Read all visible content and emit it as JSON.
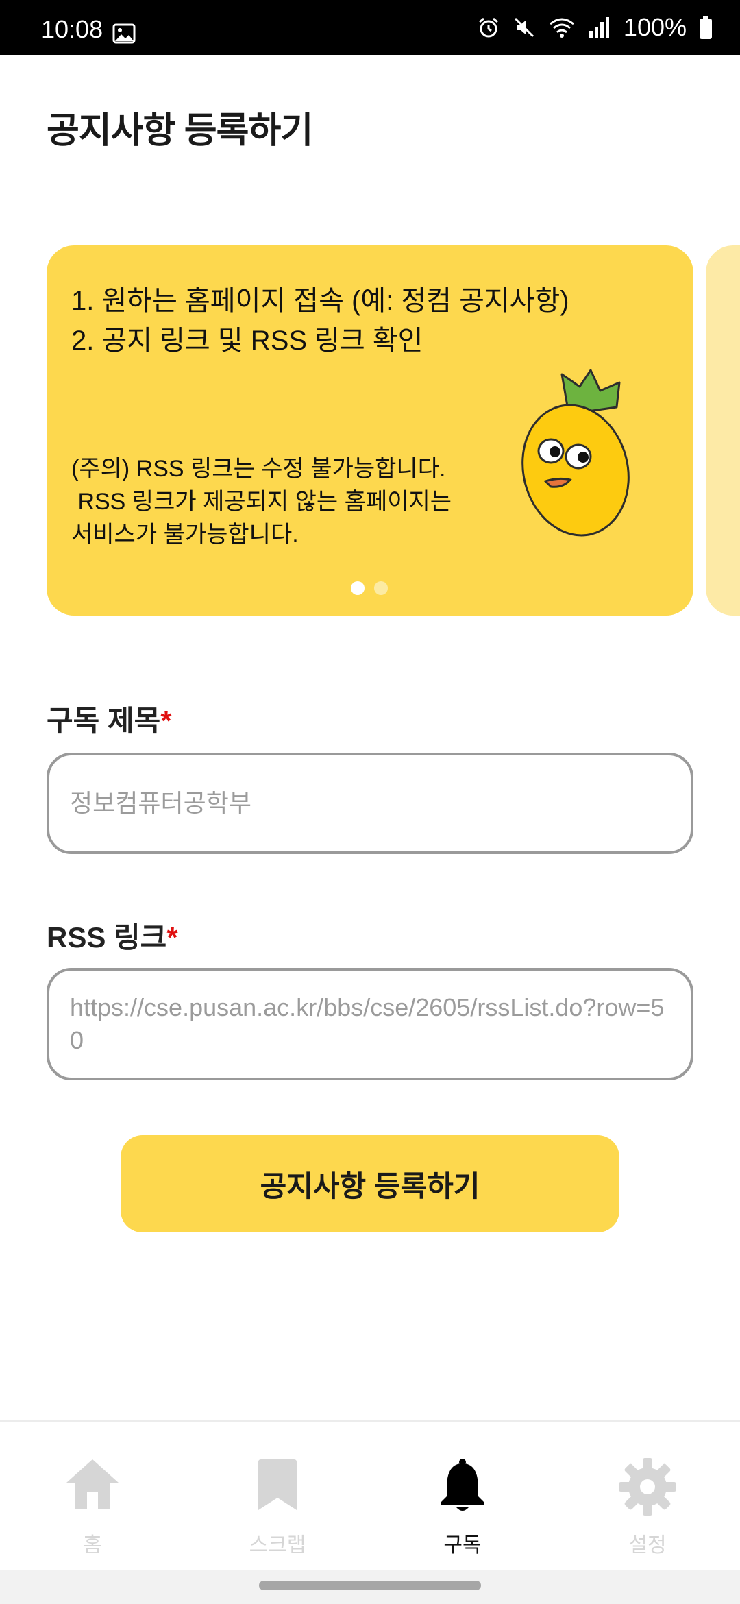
{
  "status_bar": {
    "time": "10:08",
    "battery": "100%"
  },
  "page": {
    "title": "공지사항 등록하기"
  },
  "carousel": {
    "card": {
      "steps": [
        "1. 원하는 홈페이지 접속 (예: 정컴 공지사항)",
        "2. 공지 링크 및 RSS 링크 확인"
      ],
      "notes": [
        "(주의) RSS 링크는 수정 불가능합니다.",
        " RSS 링크가 제공되지 않는 홈페이지는",
        "서비스가 불가능합니다."
      ]
    },
    "page_count": 2,
    "active_page": 1
  },
  "form": {
    "title_field": {
      "label": "구독 제목",
      "required_mark": "*",
      "placeholder": "정보컴퓨터공학부"
    },
    "rss_field": {
      "label": "RSS 링크",
      "required_mark": "*",
      "placeholder": "https://cse.pusan.ac.kr/bbs/cse/2605/rssList.do?row=50"
    },
    "submit_label": "공지사항 등록하기"
  },
  "bottom_nav": {
    "items": [
      {
        "label": "홈",
        "icon": "home-icon",
        "active": false
      },
      {
        "label": "스크랩",
        "icon": "bookmark-icon",
        "active": false
      },
      {
        "label": "구독",
        "icon": "bell-icon",
        "active": true
      },
      {
        "label": "설정",
        "icon": "gear-icon",
        "active": false
      }
    ]
  },
  "colors": {
    "accent": "#FDD84E",
    "required": "#E01010",
    "inactive_nav": "#D6D6D6"
  }
}
